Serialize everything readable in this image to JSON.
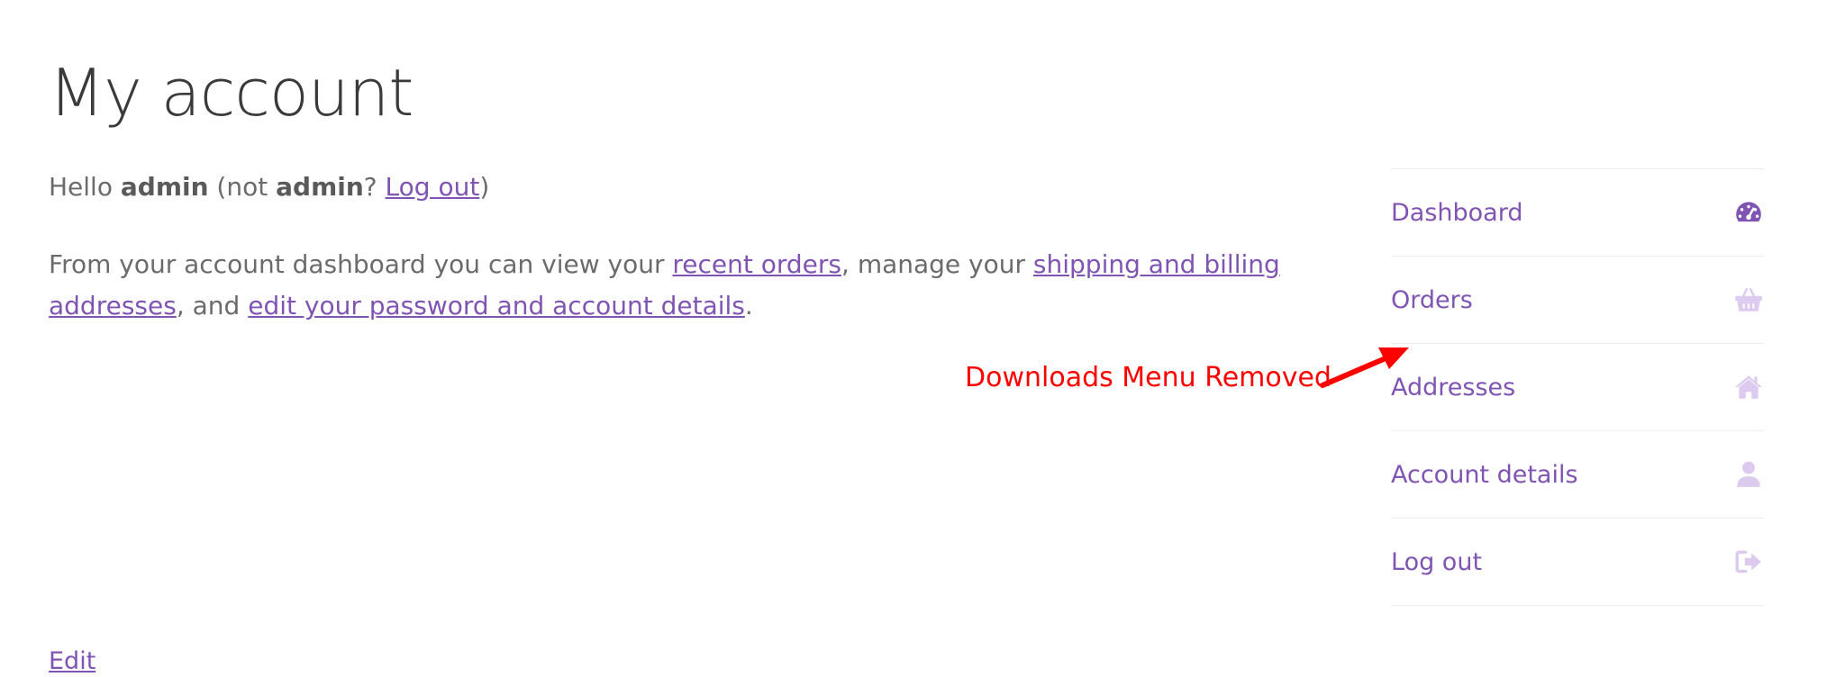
{
  "page": {
    "title": "My account"
  },
  "greeting": {
    "hello": "Hello ",
    "username": "admin",
    "not_open": " (not ",
    "username2": "admin",
    "question": "? ",
    "logout_link": "Log out",
    "close": ")"
  },
  "intro": {
    "part1": "From your account dashboard you can view your ",
    "recent_orders": "recent orders",
    "part2": ", manage your ",
    "addresses": "shipping and billing addresses",
    "part3": ", and ",
    "edit_password": "edit your password and account details",
    "part4": "."
  },
  "nav": {
    "items": [
      {
        "label": "Dashboard",
        "icon": "dashboard-icon"
      },
      {
        "label": "Orders",
        "icon": "basket-icon"
      },
      {
        "label": "Addresses",
        "icon": "home-icon"
      },
      {
        "label": "Account details",
        "icon": "user-icon"
      },
      {
        "label": "Log out",
        "icon": "logout-icon"
      }
    ]
  },
  "annotation": {
    "text": "Downloads Menu Removed"
  },
  "footer": {
    "edit_label": "Edit"
  },
  "colors": {
    "accent": "#7f54b3",
    "icon_active": "#7f54b3",
    "icon_inactive": "#dccbef",
    "annotation": "#ff0000"
  }
}
